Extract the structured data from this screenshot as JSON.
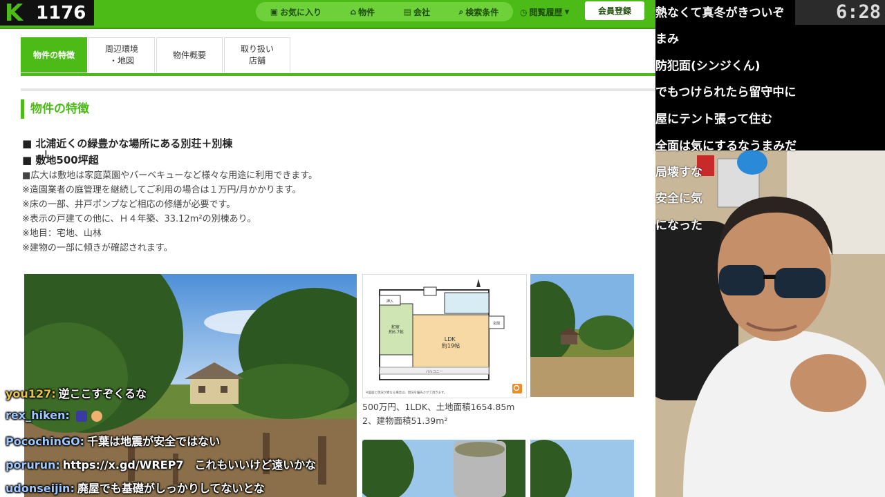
{
  "header": {
    "logo_mark": "K",
    "viewer_count": "1176",
    "nav": [
      {
        "icon": "heart-box-icon",
        "glyph": "▣",
        "label": "お気に入り"
      },
      {
        "icon": "home-icon",
        "glyph": "⌂",
        "label": "物件"
      },
      {
        "icon": "building-icon",
        "glyph": "▤",
        "label": "会社"
      },
      {
        "icon": "search-icon",
        "glyph": "⌕",
        "label": "検索条件"
      }
    ],
    "history_label": "閲覧履歴",
    "member_label": "会員登録"
  },
  "tabs": [
    {
      "label": "物件の特徴",
      "active": true
    },
    {
      "label": "周辺環境\n・地図",
      "active": false
    },
    {
      "label": "物件概要",
      "active": false
    },
    {
      "label": "取り扱い\n店舗",
      "active": false
    }
  ],
  "section_title": "物件の特徴",
  "features": {
    "headline1": "■ 北浦近くの緑豊かな場所にある別荘＋別棟",
    "headline2": "■ 敷地500坪超",
    "lines": [
      "■広大は敷地は家庭菜園やバーベキューなど様々な用途に利用できます。",
      "※造園業者の庭管理を継続してご利用の場合は１万円/月かかります。",
      "※床の一部、井戸ポンプなど相応の修繕が必要です。",
      "※表示の戸建ての他に、Ｈ４年築、33.12m²の別棟あり。",
      "※地目：宅地、山林",
      "※建物の一部に傾きが確認されます。"
    ]
  },
  "floorplan": {
    "rooms": {
      "ldk": "LDK\n約19帖",
      "washitsu": "和室\n約6.7帖",
      "balcony": "バルコニー",
      "entrance": "玄関",
      "oshi": "押入"
    },
    "note": "※図面と現況が異なる場合は、現況を優先させて頂きます。"
  },
  "property_caption_line1": "500万円、1LDK、土地面積1654.85m",
  "property_caption_line2": "2、建物面積51.39m²",
  "stream": {
    "clock": "6:28",
    "comments": [
      "熱なくて真冬がきついぞ",
      "まみ",
      "防犯面(シンジくん)",
      "でもつけられたら留守中に",
      "屋にテント張って住む",
      "全面は気にするなうまみだ",
      "局壊すな",
      "安全に気",
      "になった"
    ]
  },
  "chat": [
    {
      "user": "you127:",
      "message": "逆ここすぞくるな",
      "color": "#e8c24a"
    },
    {
      "user": "rex_hiken:",
      "message": "",
      "color": "#9ec8ff"
    },
    {
      "user": "PocochinGO:",
      "message": "千葉は地震が安全ではない",
      "color": "#9ec8ff"
    },
    {
      "user": "porurun:",
      "message": "https://x.gd/WREP7　これもいいけど遠いかな",
      "color": "#9ec8ff"
    },
    {
      "user": "udonseijin:",
      "message": "廃屋でも基礎がしっかりしてないとな",
      "color": "#9ec8ff"
    }
  ]
}
